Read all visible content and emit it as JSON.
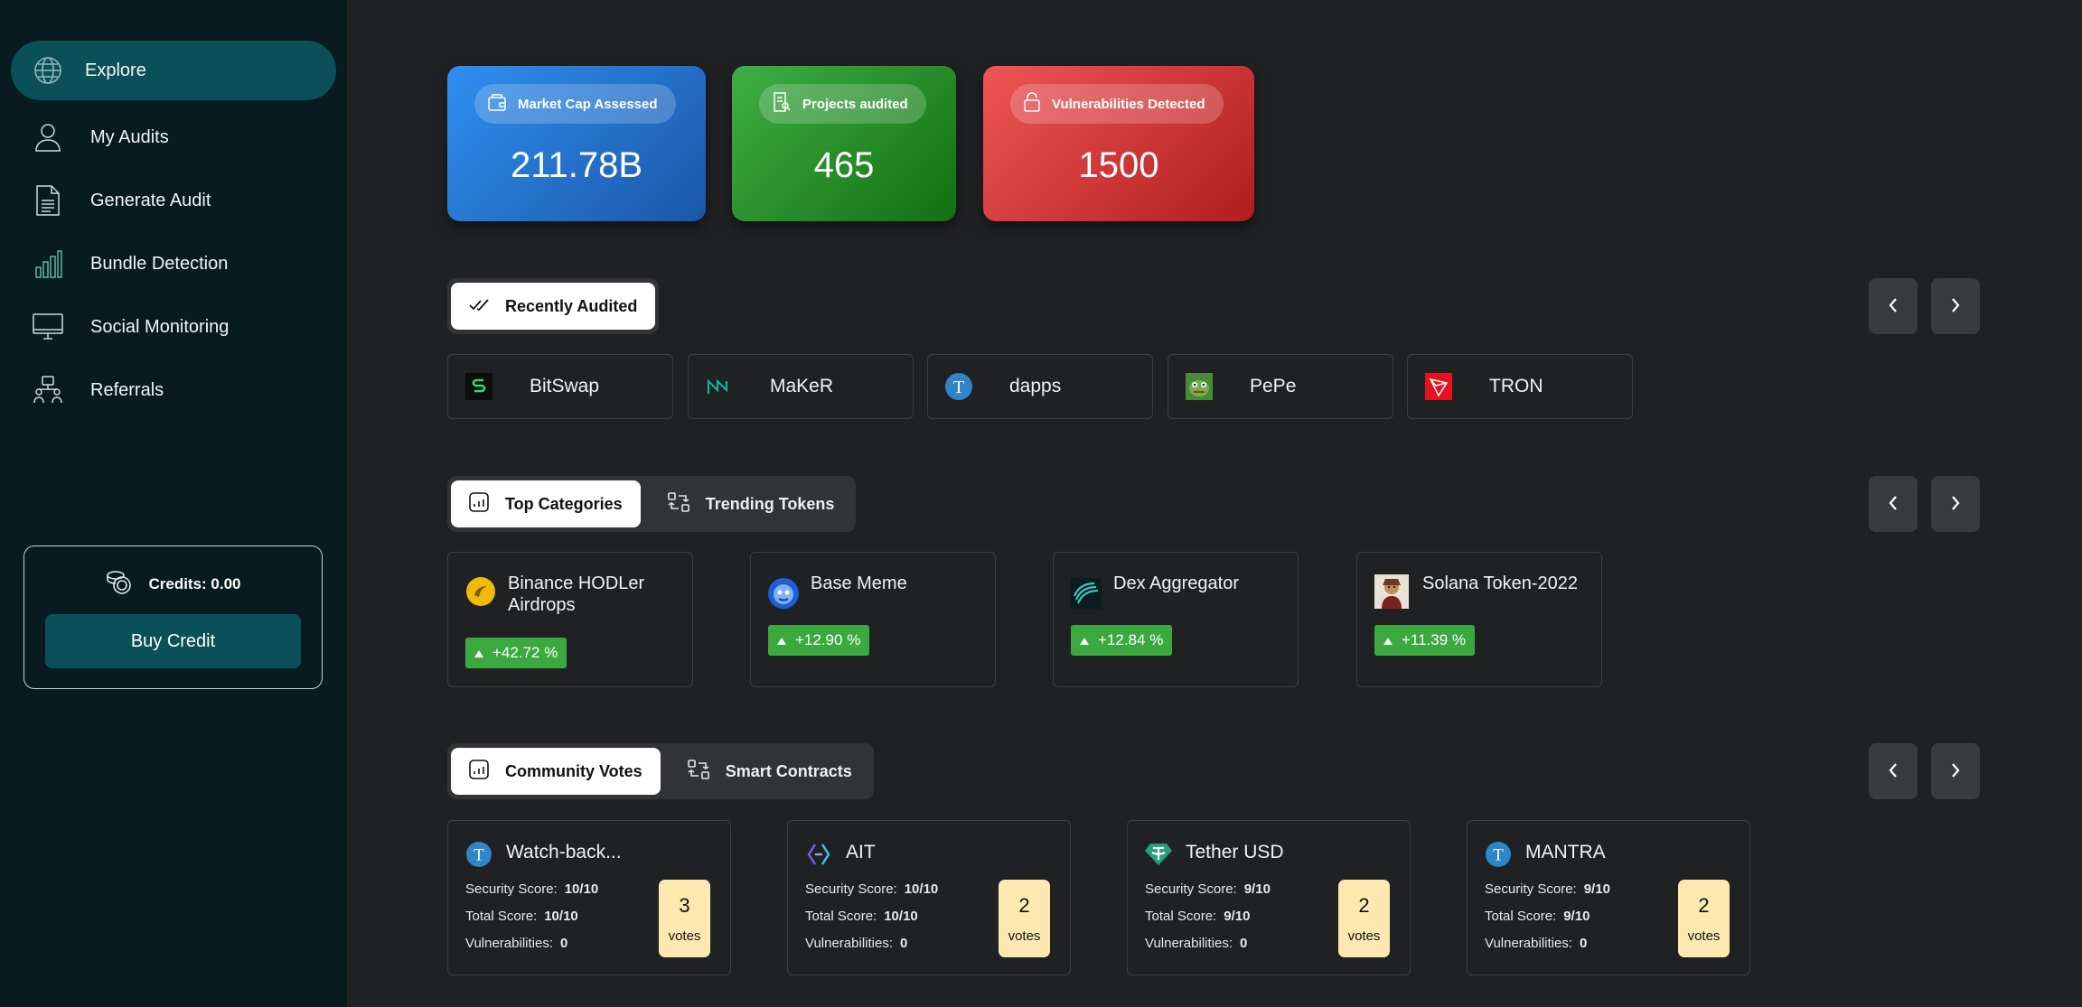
{
  "sidebar": {
    "nav": [
      {
        "label": "Explore",
        "icon": "globe-icon",
        "active": true
      },
      {
        "label": "My Audits",
        "icon": "user-icon",
        "active": false
      },
      {
        "label": "Generate Audit",
        "icon": "document-icon",
        "active": false
      },
      {
        "label": "Bundle Detection",
        "icon": "bar-chart-icon",
        "active": false
      },
      {
        "label": "Social Monitoring",
        "icon": "monitor-icon",
        "active": false
      },
      {
        "label": "Referrals",
        "icon": "network-icon",
        "active": false
      }
    ],
    "credits_label": "Credits: 0.00",
    "buy_label": "Buy Credit"
  },
  "stats": [
    {
      "label": "Market Cap Assessed",
      "value": "211.78B",
      "icon": "wallet-icon",
      "color_from": "#2f8ff0",
      "color_to": "#1b57a8"
    },
    {
      "label": "Projects audited",
      "value": "465",
      "icon": "audit-report-icon",
      "color_from": "#3fae45",
      "color_to": "#127012"
    },
    {
      "label": "Vulnerabilities Detected",
      "value": "1500",
      "icon": "lock-icon",
      "color_from": "#ee5656",
      "color_to": "#b11d1d"
    }
  ],
  "recent": {
    "tab_label": "Recently Audited",
    "items": [
      {
        "name": "BitSwap",
        "icon": "bitswap-logo-icon"
      },
      {
        "name": "MaKeR",
        "icon": "maker-logo-icon"
      },
      {
        "name": "dapps",
        "icon": "tether-t-logo-icon"
      },
      {
        "name": "PePe",
        "icon": "pepe-logo-icon"
      },
      {
        "name": "TRON",
        "icon": "tron-logo-icon"
      }
    ]
  },
  "categories": {
    "tabs": [
      {
        "label": "Top Categories",
        "active": true
      },
      {
        "label": "Trending Tokens",
        "active": false
      }
    ],
    "items": [
      {
        "name": "Binance HODLer Airdrops",
        "change": "+42.72 %",
        "icon": "binance-hodler-logo-icon"
      },
      {
        "name": "Base Meme",
        "change": "+12.90 %",
        "icon": "base-meme-logo-icon"
      },
      {
        "name": "Dex Aggregator",
        "change": "+12.84 %",
        "icon": "dex-aggregator-logo-icon"
      },
      {
        "name": "Solana Token-2022",
        "change": "+11.39 %",
        "icon": "solana-token-logo-icon"
      }
    ]
  },
  "community": {
    "tabs": [
      {
        "label": "Community Votes",
        "active": true
      },
      {
        "label": "Smart Contracts",
        "active": false
      }
    ],
    "security_label": "Security Score:",
    "total_label": "Total Score:",
    "vuln_label": "Vulnerabilities:",
    "votes_label": "votes",
    "items": [
      {
        "name": "Watch-back...",
        "security": "10/10",
        "total": "10/10",
        "vulnerabilities": "0",
        "votes": "3",
        "icon": "tether-t-logo-icon"
      },
      {
        "name": "AIT",
        "security": "10/10",
        "total": "10/10",
        "vulnerabilities": "0",
        "votes": "2",
        "icon": "ait-logo-icon"
      },
      {
        "name": "Tether USD",
        "security": "9/10",
        "total": "9/10",
        "vulnerabilities": "0",
        "votes": "2",
        "icon": "tether-usd-logo-icon"
      },
      {
        "name": "MANTRA",
        "security": "9/10",
        "total": "9/10",
        "vulnerabilities": "0",
        "votes": "2",
        "icon": "tether-t-logo-icon"
      }
    ]
  },
  "colors": {
    "accent": "#0b5059",
    "sidebar_bg": "#071b20",
    "main_bg": "#202123",
    "gain": "#3ba93f",
    "vote_badge": "#fde9b0"
  }
}
